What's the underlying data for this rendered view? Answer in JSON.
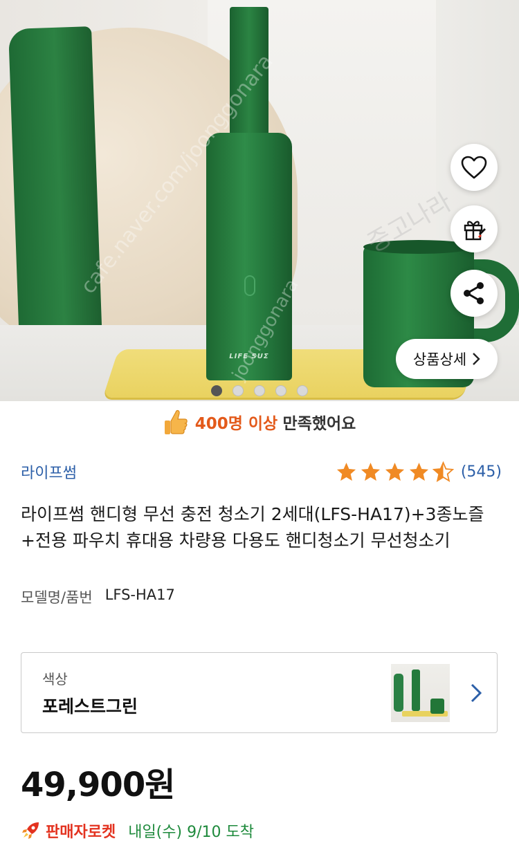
{
  "hero": {
    "device_brand": "LIFE SUΣ",
    "watermark_1": "cafe.naver.com/joonggonara",
    "watermark_2": "joonggonara",
    "watermark_3": "중고나라",
    "detail_button_label": "상품상세",
    "carousel": {
      "count": 5,
      "active_index": 0
    }
  },
  "satisfaction": {
    "highlight": "400명 이상",
    "rest": "만족했어요"
  },
  "product": {
    "brand": "라이프썸",
    "rating": 4.5,
    "rating_count": "(545)",
    "title": "라이프썸 핸디형 무선 충전 청소기 2세대(LFS-HA17)+3종노즐+전용 파우치 휴대용 차량용 다용도 핸디청소기 무선청소기",
    "model_label": "모델명/품번",
    "model_value": "LFS-HA17"
  },
  "option": {
    "label": "색상",
    "value": "포레스트그린"
  },
  "price": "49,900원",
  "delivery": {
    "badge": "판매자로켓",
    "date": "내일(수) 9/10 도착"
  },
  "colors": {
    "accent_blue": "#2c5fa8",
    "satisfaction_orange": "#e35a1b",
    "star_orange": "#f08a24",
    "rocket_red": "#e3321f",
    "delivery_green": "#1e8a3c"
  }
}
